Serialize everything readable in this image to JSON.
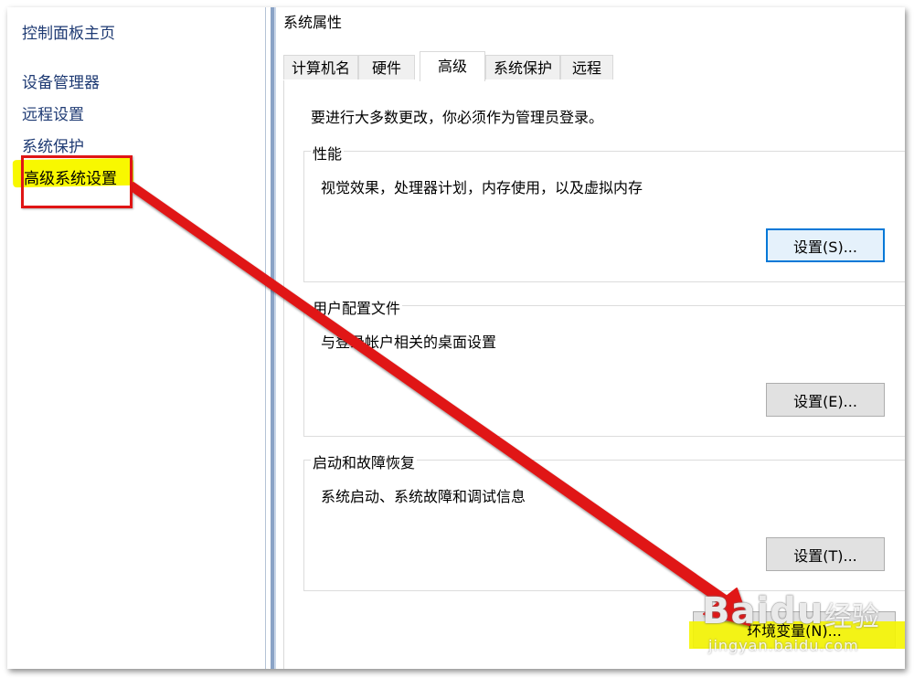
{
  "control_panel": {
    "home": "控制面板主页",
    "links": [
      "设备管理器",
      "远程设置",
      "系统保护",
      "高级系统设置"
    ]
  },
  "dialog": {
    "title": "系统属性",
    "tabs": [
      "计算机名",
      "硬件",
      "高级",
      "系统保护",
      "远程"
    ],
    "active_tab": "高级",
    "admin_note": "要进行大多数更改，你必须作为管理员登录。",
    "groups": [
      {
        "title": "性能",
        "description": "视觉效果，处理器计划，内存使用，以及虚拟内存",
        "button": "设置(S)..."
      },
      {
        "title": "用户配置文件",
        "description": "与登录帐户相关的桌面设置",
        "button": "设置(E)..."
      },
      {
        "title": "启动和故障恢复",
        "description": "系统启动、系统故障和调试信息",
        "button": "设置(T)..."
      }
    ],
    "env_button": "环境变量(N)..."
  },
  "annotation": {
    "highlight_color": "#f8f800",
    "box_color": "#e01515",
    "arrow_color": "#e01515"
  },
  "watermark": {
    "logo": "Baidu",
    "logo_cn": "经验",
    "url": "jingyan.baidu.com"
  }
}
